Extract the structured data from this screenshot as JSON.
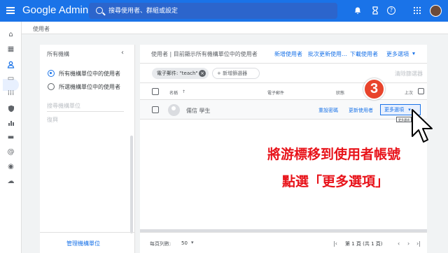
{
  "topbar": {
    "brand": "Google Admin",
    "search_placeholder": "搜尋使用者、群組或設定",
    "icons": [
      "bell-icon",
      "hourglass-icon",
      "help-icon",
      "apps-grid-icon"
    ]
  },
  "breadcrumb": "使用者",
  "left_panel": {
    "title": "所有機構",
    "options": [
      "所有機構單位中的使用者",
      "所選機構單位中的使用者"
    ],
    "search_placeholder": "搜尋機構單位",
    "org_item": "復興",
    "footer_link": "管理機構單位"
  },
  "main": {
    "title": "使用者 | 目前顯示所有機構單位中的使用者",
    "actions": [
      "新增使用者",
      "批次更新使用…",
      "下載使用者",
      "更多選項"
    ],
    "chip": "電子郵件: \"teach\"",
    "add_filter": "新增篩選器",
    "clear_filters": "清除篩選器",
    "columns": {
      "name": "名稱",
      "sort_arrow": "↑",
      "email": "電子郵件",
      "status": "狀態",
      "last": "上次"
    },
    "row": {
      "name": "儒信 學生",
      "reset": "重設密碼",
      "rename": "更新使用者",
      "more": "更多選項"
    },
    "tooltip": "更多選項",
    "footer": {
      "per_page_label": "每頁列數:",
      "per_page_value": "50",
      "page_label": "第 1 頁 (共 1 頁)"
    }
  },
  "annotation": {
    "step": "3",
    "line1": "將游標移到使用者帳號",
    "line2": "點選「更多選項」"
  },
  "colors": {
    "brand_blue": "#1a73e8",
    "annotation_red": "#e8131a",
    "badge_red": "#e8442c"
  }
}
